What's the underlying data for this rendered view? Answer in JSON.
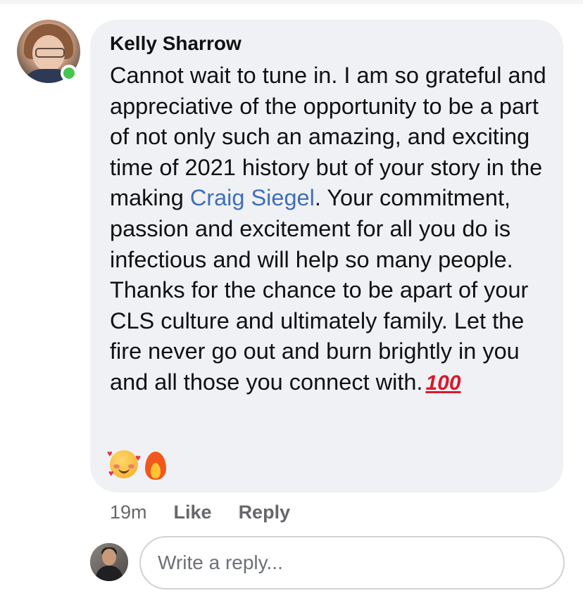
{
  "comment": {
    "author": "Kelly Sharrow",
    "text_before_mention": "Cannot wait to tune in. I am so grateful and appreciative of the opportunity to be a part of not only such an amazing, and exciting time of 2021 history but of your story in the making ",
    "mention": "Craig Siegel",
    "text_after_mention": ". Your commitment, passion and excitement for all you do is infectious and will help so many people. Thanks for the chance to be apart of your CLS culture and ultimately family. Let the fire never go out and burn brightly in you and all those you connect with.",
    "hundred_emoji_text": "100",
    "emojis": [
      "smiling-face-with-hearts-icon",
      "fire-icon"
    ],
    "time": "19m",
    "like_label": "Like",
    "reply_label": "Reply",
    "author_online": true
  },
  "reply_box": {
    "placeholder": "Write a reply..."
  },
  "colors": {
    "bubble": "#f0f1f5",
    "mention": "#3f6fb7",
    "online": "#44c64f",
    "meta": "#65676b"
  }
}
